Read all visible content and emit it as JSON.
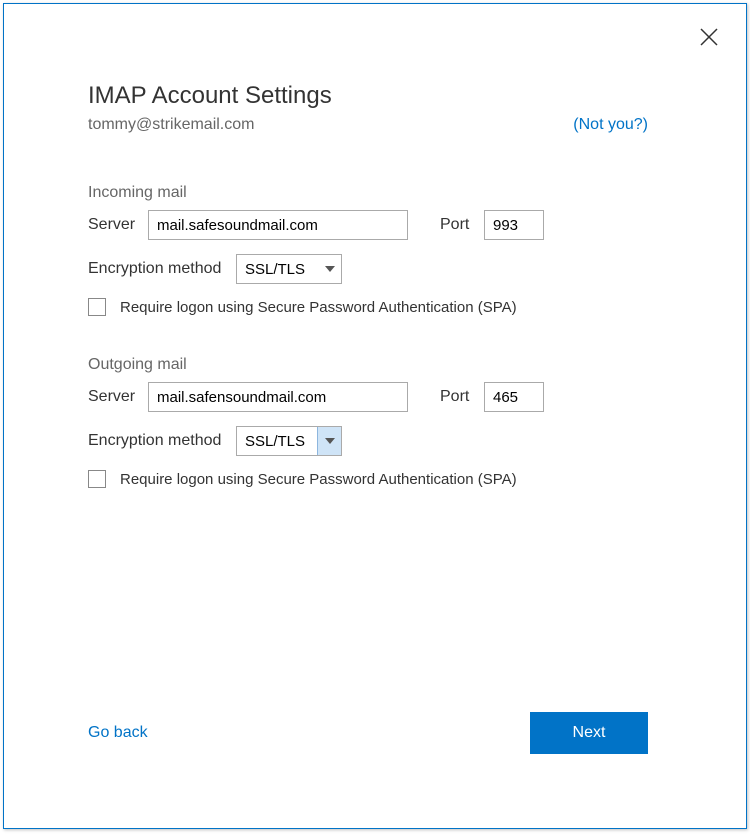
{
  "title": "IMAP Account Settings",
  "email": "tommy@strikemail.com",
  "not_you": "(Not you?)",
  "labels": {
    "server": "Server",
    "port": "Port",
    "encryption": "Encryption method"
  },
  "incoming": {
    "section_title": "Incoming mail",
    "server": "mail.safesoundmail.com",
    "port": "993",
    "encryption": "SSL/TLS",
    "spa_label": "Require logon using Secure Password Authentication (SPA)"
  },
  "outgoing": {
    "section_title": "Outgoing mail",
    "server": "mail.safensoundmail.com",
    "port": "465",
    "encryption": "SSL/TLS",
    "spa_label": "Require logon using Secure Password Authentication (SPA)"
  },
  "footer": {
    "go_back": "Go back",
    "next": "Next"
  }
}
